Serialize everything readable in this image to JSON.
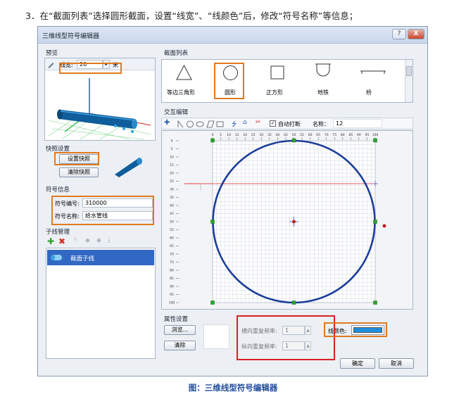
{
  "instruction": "3．在“截面列表”选择圆形截面，设置“线宽”、“线颜色”后，修改“符号名称”等信息；",
  "caption": "图：三维线型符号编辑器",
  "window": {
    "title": "三维线型符号编辑器",
    "help_label": "?",
    "close_label": "X"
  },
  "preview": {
    "section_title": "预览",
    "line_width_label": "线宽:",
    "line_width_value": "20",
    "line_width_unit": "米"
  },
  "snapshot": {
    "section_title": "快照设置",
    "set_button": "设置快照",
    "clear_button": "清除快照"
  },
  "symbol_info": {
    "section_title": "符号信息",
    "id_label": "符号编号:",
    "id_value": "310000",
    "name_label": "符号名称:",
    "name_value": "给水管线"
  },
  "subline": {
    "section_title": "子线管理",
    "items": [
      {
        "label": "截面子线",
        "selected": true
      }
    ]
  },
  "section_list": {
    "section_title": "截面列表",
    "shapes": [
      {
        "label": "等边三角形",
        "icon": "triangle-icon"
      },
      {
        "label": "圆形",
        "icon": "circle-icon",
        "selected": true
      },
      {
        "label": "正方形",
        "icon": "square-icon"
      },
      {
        "label": "地铁",
        "icon": "subway-icon"
      },
      {
        "label": "桥",
        "icon": "bridge-icon"
      }
    ]
  },
  "interactive_edit": {
    "section_title": "交互编辑",
    "auto_snap_label": "自动打断",
    "auto_snap_checked": true,
    "name_label": "名称：",
    "name_value": "12",
    "ruler_top": [
      "0",
      "5",
      "10",
      "15",
      "20",
      "25",
      "30",
      "35",
      "40",
      "45",
      "50",
      "55",
      "60",
      "65",
      "70",
      "75",
      "80",
      "85",
      "90",
      "95",
      "100"
    ],
    "ruler_left": [
      "0",
      "5",
      "10",
      "15",
      "20",
      "25",
      "30",
      "35",
      "40",
      "45",
      "50",
      "55",
      "60",
      "65",
      "70",
      "75",
      "80",
      "85",
      "90",
      "95",
      "100"
    ],
    "circle_color": "#1b3d9a",
    "guide_color": "#e02020"
  },
  "attributes": {
    "section_title": "属性设置",
    "browse_button": "浏览...",
    "clear_button": "清除",
    "h_repeat_label": "横向重复频率:",
    "h_repeat_value": "1",
    "v_repeat_label": "纵向重复频率:",
    "v_repeat_value": "1",
    "line_color_label": "线颜色:",
    "line_color": "#1e8fe0"
  },
  "footer": {
    "ok_button": "确定",
    "cancel_button": "取消"
  },
  "colors": {
    "highlight": "#e07a20",
    "selection": "#3168c4"
  }
}
